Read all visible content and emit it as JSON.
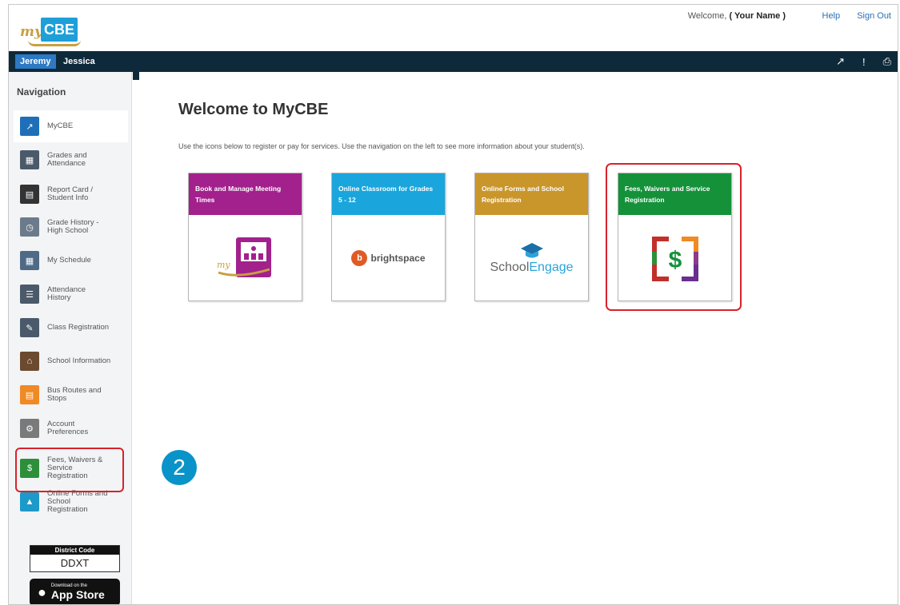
{
  "header": {
    "logo_my": "my",
    "logo_cbe": "CBE",
    "welcome_prefix": "Welcome,",
    "user_name": "( Your Name )",
    "help": "Help",
    "sign_out": "Sign Out"
  },
  "students": {
    "active": "Jeremy",
    "other": "Jessica"
  },
  "toolbar_icons": [
    "external-link-icon",
    "alert-icon",
    "print-icon"
  ],
  "sidebar": {
    "title": "Navigation",
    "items": [
      {
        "label": "MyCBE",
        "icon": "arrow-icon",
        "color": "#1f6fb8"
      },
      {
        "label": "Grades and Attendance",
        "icon": "grades-icon",
        "color": "#4b5a6a"
      },
      {
        "label": "Report Card / Student Info",
        "icon": "report-card-icon",
        "color": "#333333"
      },
      {
        "label": "Grade History - High School",
        "icon": "grade-history-icon",
        "color": "#6b7b8b"
      },
      {
        "label": "My Schedule",
        "icon": "calendar-icon",
        "color": "#4f6a86"
      },
      {
        "label": "Attendance History",
        "icon": "attendance-icon",
        "color": "#4b5a6a"
      },
      {
        "label": "Class Registration",
        "icon": "class-registration-icon",
        "color": "#4b5a6a"
      },
      {
        "label": "School Information",
        "icon": "school-icon",
        "color": "#6b4a2f"
      },
      {
        "label": "Bus Routes and Stops",
        "icon": "bus-icon",
        "color": "#f08a24"
      },
      {
        "label": "Account Preferences",
        "icon": "account-icon",
        "color": "#7a7a7a"
      },
      {
        "label": "Fees, Waivers & Service Registration",
        "icon": "dollar-icon",
        "color": "#2d8f3a"
      },
      {
        "label": "Online Forms and School Registration",
        "icon": "graduation-cap-icon",
        "color": "#1c9ac9"
      }
    ],
    "district_title": "District Code",
    "district_code": "DDXT",
    "appstore_small": "Download on the",
    "appstore_big": "App Store"
  },
  "main": {
    "title": "Welcome to MyCBE",
    "intro": "Use the icons below to register or pay for services. Use the navigation on the left to see more information about your student(s).",
    "tiles": [
      {
        "title": "Book and Manage Meeting Times",
        "color": "#a2218c",
        "icon": "meeting-icon"
      },
      {
        "title": "Online Classroom for Grades 5 - 12",
        "color": "#1aa6dc",
        "icon": "brightspace-logo",
        "brand": "brightspace"
      },
      {
        "title": "Online Forms and School Registration",
        "color": "#c9962c",
        "icon": "schoolengage-logo",
        "brand_a": "School",
        "brand_b": "Engage"
      },
      {
        "title": "Fees, Waivers and Service Registration",
        "color": "#15913a",
        "icon": "dollar-icon"
      }
    ]
  },
  "step_badge": "2",
  "colors": {
    "navy": "#0e2a3a",
    "highlight": "#d8222a",
    "badge": "#0a93c9"
  }
}
